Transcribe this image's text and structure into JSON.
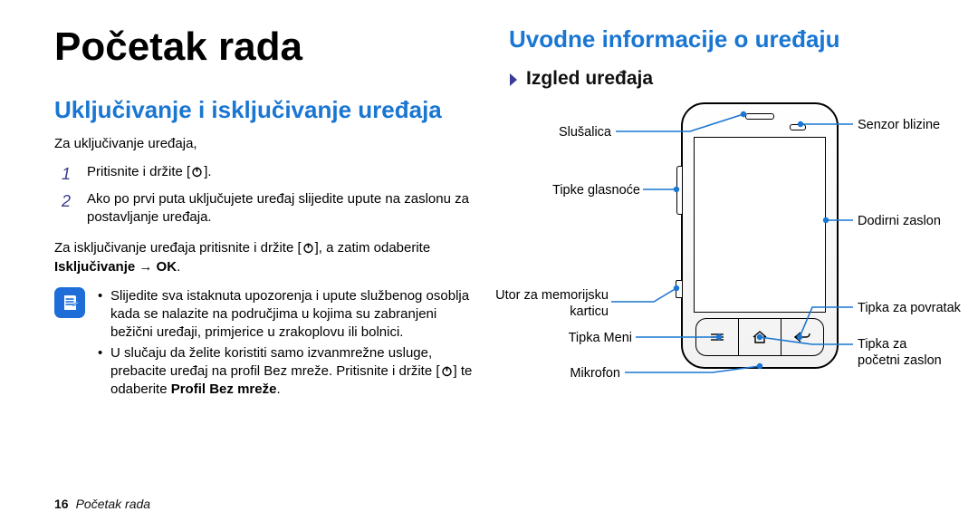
{
  "title": "Početak rada",
  "left_heading": "Uključivanje i isključivanje uređaja",
  "intro": "Za uključivanje uređaja,",
  "step1": "Pritisnite i držite [",
  "step1_end": "].",
  "step2": "Ako po prvi puta uključujete uređaj slijedite upute na zaslonu za postavljanje uređaja.",
  "off_a": "Za isključivanje uređaja pritisnite i držite [",
  "off_b": "], a zatim odaberite ",
  "off_bold": "Isključivanje → OK",
  "off_c": ".",
  "note1": "Slijedite sva istaknuta upozorenja i upute službenog osoblja kada se nalazite na područjima u kojima su zabranjeni bežični uređaji, primjerice u zrakoplovu ili bolnici.",
  "note2_a": "U slučaju da želite koristiti samo izvanmrežne usluge, prebacite uređaj na profil Bez mreže. Pritisnite i držite [",
  "note2_b": "] te odaberite ",
  "note2_bold": "Profil Bez mreže",
  "note2_c": ".",
  "r_heading": "Uvodne informacije o uređaju",
  "r_sub": "Izgled uređaja",
  "labels": {
    "earpiece": "Slušalica",
    "sensor": "Senzor blizine",
    "volume": "Tipke glasnoće",
    "touch": "Dodirni zaslon",
    "sd_a": "Utor za memorijsku",
    "sd_b": "karticu",
    "menu": "Tipka Meni",
    "mic": "Mikrofon",
    "back": "Tipka za povratak",
    "home_a": "Tipka za",
    "home_b": "početni zaslon"
  },
  "footer_page": "16",
  "footer_section": "Početak rada"
}
